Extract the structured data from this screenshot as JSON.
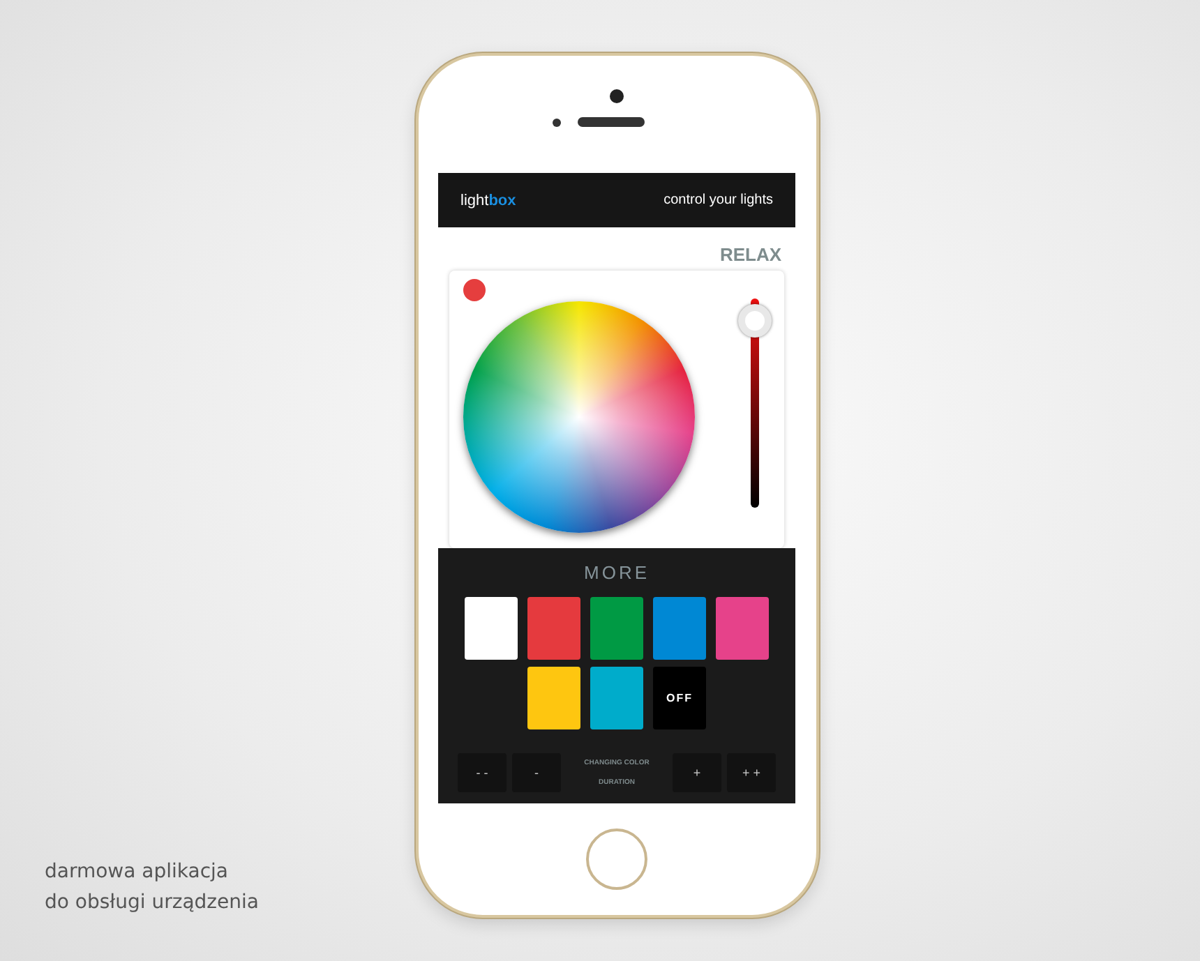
{
  "header": {
    "logo_parts": [
      {
        "text": "light",
        "kind": "plain"
      },
      {
        "text": "box",
        "kind": "accent"
      }
    ],
    "tagline": "control your lights"
  },
  "mode": "RELAX",
  "picker": {
    "color": "#e53e3e",
    "brightness": {
      "level": 0.97
    }
  },
  "more_label": "MORE",
  "swatches": [
    {
      "kind": "color",
      "color": "#ffffff"
    },
    {
      "kind": "color",
      "color": "#e53a3e"
    },
    {
      "kind": "color",
      "color": "#009a44"
    },
    {
      "kind": "color",
      "color": "#0088d4"
    },
    {
      "kind": "color",
      "color": "#e6428a"
    },
    {
      "kind": "color",
      "color": "#fec610"
    },
    {
      "kind": "color",
      "color": "#00accb"
    },
    {
      "kind": "off",
      "label": "OFF"
    }
  ],
  "duration": {
    "left_buttons": [
      "- -",
      "-"
    ],
    "label_lines": [
      "CHANGING COLOR",
      "DURATION"
    ],
    "right_buttons": [
      "+",
      "+ +"
    ]
  },
  "caption": [
    "darmowa aplikacja",
    "do obsługi urządzenia"
  ]
}
